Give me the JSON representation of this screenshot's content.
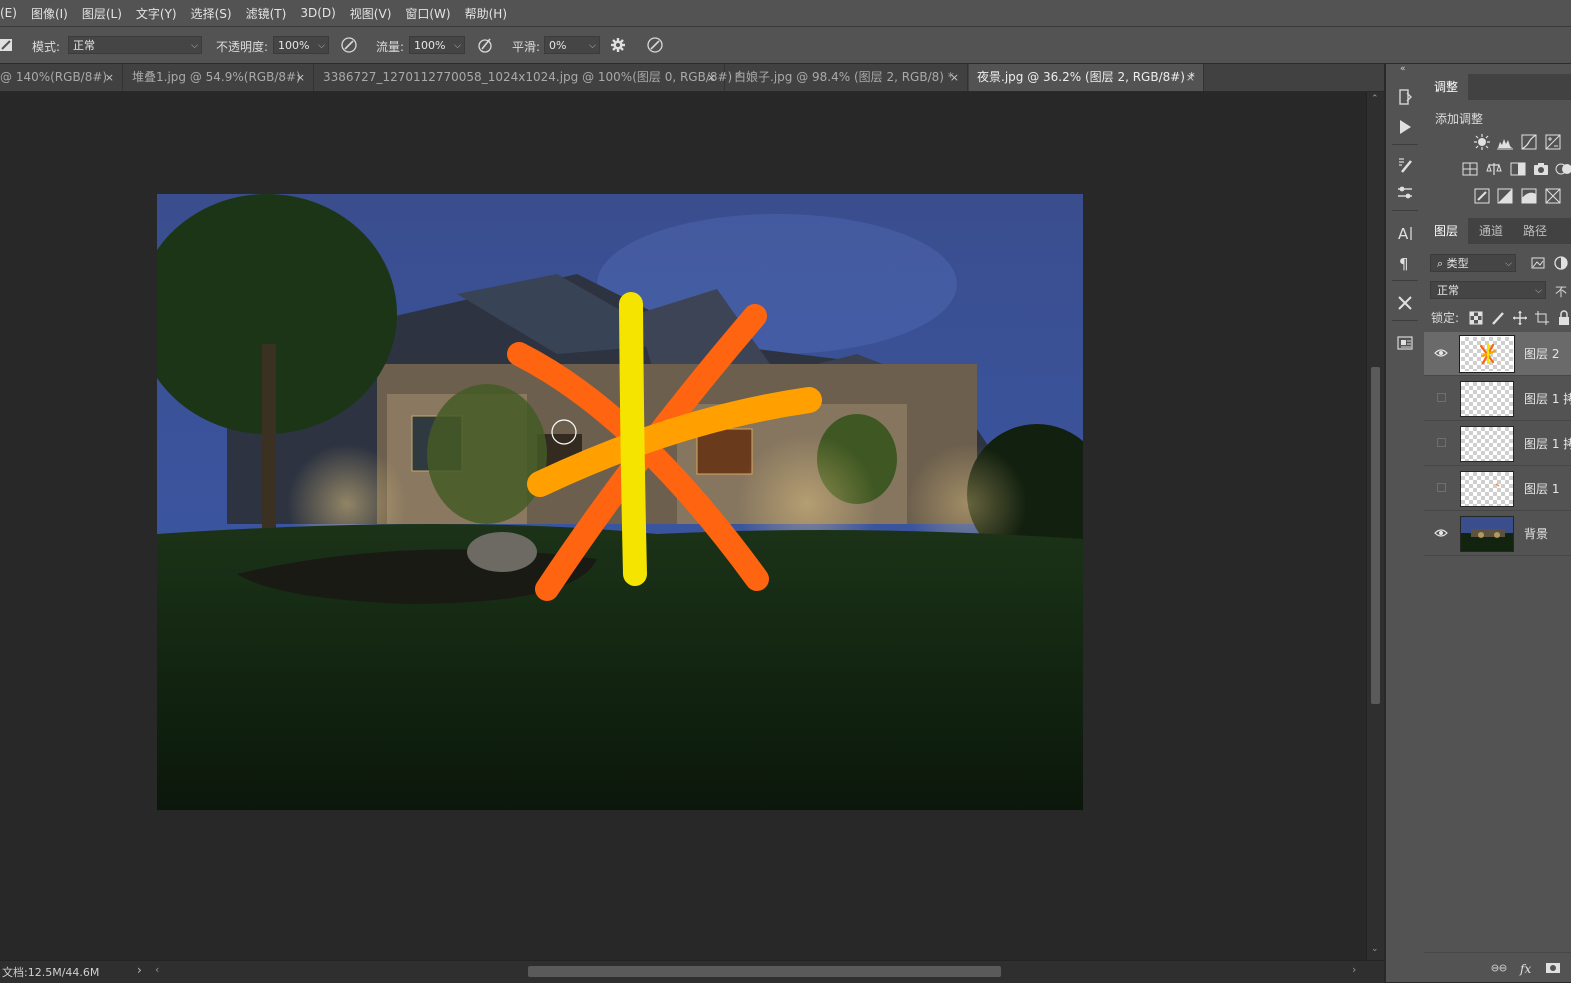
{
  "menu": [
    "(E)",
    "图像(I)",
    "图层(L)",
    "文字(Y)",
    "选择(S)",
    "滤镜(T)",
    "3D(D)",
    "视图(V)",
    "窗口(W)",
    "帮助(H)"
  ],
  "options": {
    "mode_label": "模式:",
    "mode_value": "正常",
    "opacity_label": "不透明度:",
    "opacity_value": "100%",
    "flow_label": "流量:",
    "flow_value": "100%",
    "smooth_label": "平滑:",
    "smooth_value": "0%"
  },
  "tabs": [
    {
      "label": "@ 140%(RGB/8#)",
      "close": "×"
    },
    {
      "label": "堆叠1.jpg @ 54.9%(RGB/8#)",
      "close": "×"
    },
    {
      "label": "3386727_1270112770058_1024x1024.jpg @ 100%(图层 0, RGB/8#) *",
      "close": "×"
    },
    {
      "label": "白娘子.jpg @ 98.4% (图层 2, RGB/8) *",
      "close": "×"
    },
    {
      "label": "夜景.jpg @ 36.2% (图层 2, RGB/8#) *",
      "close": "×"
    }
  ],
  "status": {
    "doc": "文档:12.5M/44.6M",
    "arrow": "›"
  },
  "adjust_panel": {
    "tab": "调整",
    "subtitle": "添加调整"
  },
  "layers_panel": {
    "tabs": [
      "图层",
      "通道",
      "路径"
    ],
    "filter_value": "类型",
    "blend_value": "正常",
    "opacity_short": "不",
    "lock_label": "锁定:",
    "layers": [
      {
        "name": "图层 2",
        "visible": true,
        "selected": true
      },
      {
        "name": "图层 1 拷",
        "visible": false,
        "selected": false
      },
      {
        "name": "图层 1 拷",
        "visible": false,
        "selected": false
      },
      {
        "name": "图层 1",
        "visible": false,
        "selected": false
      },
      {
        "name": "背景",
        "visible": true,
        "selected": false
      }
    ]
  },
  "colors": {
    "panel": "#535353",
    "canvas_bg": "#282828",
    "stroke_yellow": "#f5e400",
    "stroke_orange": "#ff6410",
    "stroke_amber": "#ffa000"
  }
}
